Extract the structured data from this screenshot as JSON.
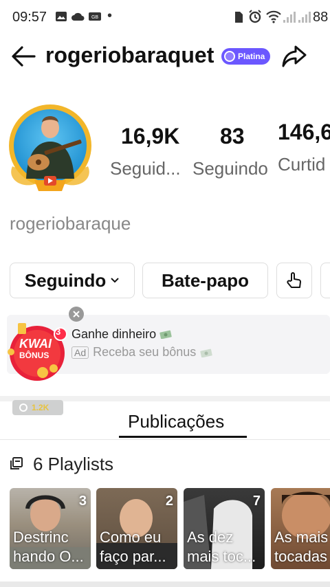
{
  "status_bar": {
    "time": "09:57",
    "dot": "•",
    "battery": "88"
  },
  "header": {
    "username": "rogeriobaraquet",
    "badge": "Platina"
  },
  "stats": [
    {
      "value": "16,9K",
      "label": "Seguid..."
    },
    {
      "value": "83",
      "label": "Seguindo"
    },
    {
      "value": "146,6",
      "label": "Curtid"
    }
  ],
  "profile": {
    "display_name": "rogeriobaraque"
  },
  "buttons": {
    "follow": "Seguindo",
    "chat": "Bate-papo"
  },
  "ad": {
    "badge_count": "3",
    "logo_line1": "KWAI",
    "logo_line2": "BÔNUS",
    "title": "Ganhe dinheiro",
    "tag": "Ad",
    "subtitle": "Receba seu bônus",
    "coin_value": "1.2K"
  },
  "tabs": {
    "active": "Publicações"
  },
  "playlists": {
    "title": "6 Playlists",
    "items": [
      {
        "count": "3",
        "caption": "Destrinc\nhando O..."
      },
      {
        "count": "2",
        "caption": "Como eu\nfaço par..."
      },
      {
        "count": "7",
        "caption": "As dez\nmais toc..."
      },
      {
        "count": "",
        "caption": "As mais\ntocadas"
      }
    ]
  },
  "colors": {
    "badge": "#6b57ff",
    "ad_red": "#e8213a",
    "avatar_ring": "#f2b62a"
  }
}
